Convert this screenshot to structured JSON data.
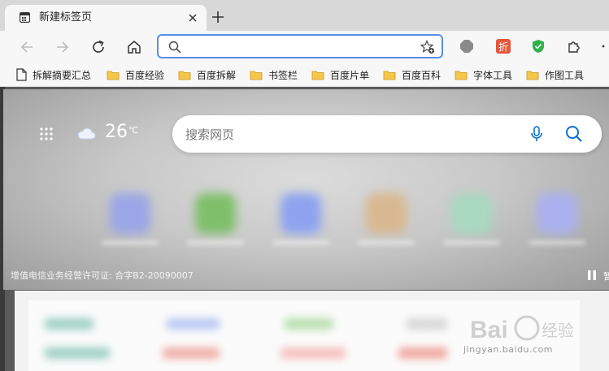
{
  "tab": {
    "title": "新建标签页"
  },
  "address_bar": {
    "value": "",
    "placeholder": ""
  },
  "bookmarks": [
    {
      "label": "拆解摘要汇总",
      "type": "page"
    },
    {
      "label": "百度经验",
      "type": "folder"
    },
    {
      "label": "百度拆解",
      "type": "folder"
    },
    {
      "label": "书签栏",
      "type": "folder"
    },
    {
      "label": "百度片单",
      "type": "folder"
    },
    {
      "label": "百度百科",
      "type": "folder"
    },
    {
      "label": "字体工具",
      "type": "folder"
    },
    {
      "label": "作图工具",
      "type": "folder"
    }
  ],
  "weather": {
    "temperature": "26",
    "unit": "℃",
    "icon": "cloud-icon"
  },
  "search": {
    "placeholder": "搜索网页"
  },
  "license": "增值电信业务经营许可证: 合字B2-20090007",
  "pause_label_fragment": "暂",
  "extensions": [
    "shield-gray-icon",
    "discount-icon",
    "shield-green-icon",
    "puzzle-icon"
  ],
  "discount_label": "折",
  "watermark": {
    "text": "jingyan.baidu.com",
    "brand": "Bai经验"
  },
  "colors": {
    "accent": "#0b6fd1",
    "address_border": "#5b8ee8",
    "ext_orange": "#e8553a",
    "ext_green": "#2fb24b"
  }
}
